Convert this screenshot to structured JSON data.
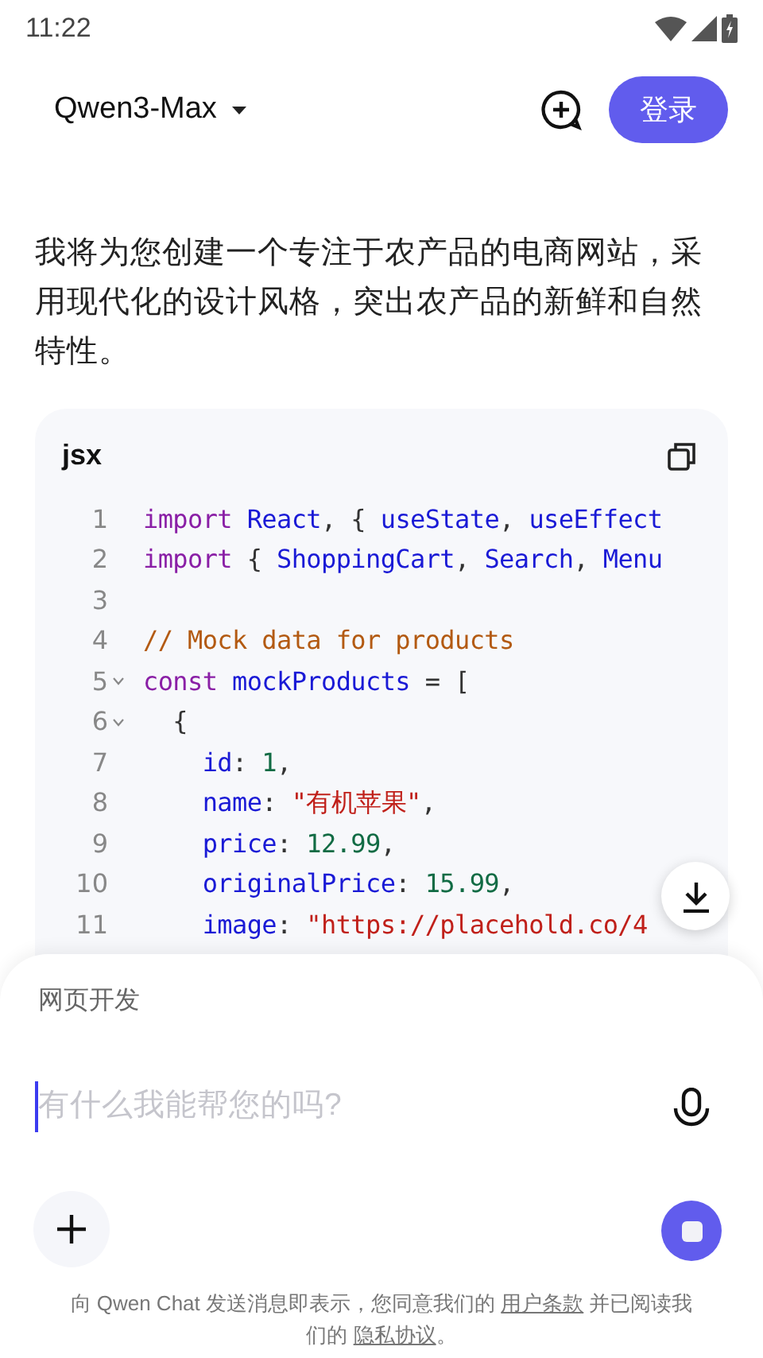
{
  "status_bar": {
    "time": "11:22"
  },
  "header": {
    "model": "Qwen3-Max",
    "login": "登录"
  },
  "message": {
    "text": "我将为您创建一个专注于农产品的电商网站，采用现代化的设计风格，突出农产品的新鲜和自然特性。"
  },
  "code_block": {
    "language": "jsx",
    "lines": [
      {
        "number": "1",
        "foldable": false,
        "tokens": [
          {
            "kind": "keyword",
            "text": "import "
          },
          {
            "kind": "name",
            "text": "React"
          },
          {
            "kind": "plain",
            "text": ", { "
          },
          {
            "kind": "name",
            "text": "useState"
          },
          {
            "kind": "plain",
            "text": ", "
          },
          {
            "kind": "name",
            "text": "useEffect"
          }
        ]
      },
      {
        "number": "2",
        "foldable": false,
        "tokens": [
          {
            "kind": "keyword",
            "text": "import "
          },
          {
            "kind": "plain",
            "text": "{ "
          },
          {
            "kind": "name",
            "text": "ShoppingCart"
          },
          {
            "kind": "plain",
            "text": ", "
          },
          {
            "kind": "name",
            "text": "Search"
          },
          {
            "kind": "plain",
            "text": ", "
          },
          {
            "kind": "name",
            "text": "Menu"
          }
        ]
      },
      {
        "number": "3",
        "foldable": false
      },
      {
        "number": "4",
        "foldable": false,
        "tokens": [
          {
            "kind": "comment",
            "text": "// Mock data for products"
          }
        ]
      },
      {
        "number": "5",
        "foldable": true,
        "tokens": [
          {
            "kind": "keyword",
            "text": "const "
          },
          {
            "kind": "name",
            "text": "mockProducts"
          },
          {
            "kind": "plain",
            "text": " = ["
          }
        ]
      },
      {
        "number": "6",
        "foldable": true,
        "tokens": [
          {
            "kind": "plain",
            "text": "  {"
          }
        ]
      },
      {
        "number": "7",
        "foldable": false,
        "tokens": [
          {
            "kind": "property",
            "text": "    id"
          },
          {
            "kind": "plain",
            "text": ": "
          },
          {
            "kind": "number",
            "text": "1"
          },
          {
            "kind": "plain",
            "text": ","
          }
        ]
      },
      {
        "number": "8",
        "foldable": false,
        "tokens": [
          {
            "kind": "property",
            "text": "    name"
          },
          {
            "kind": "plain",
            "text": ": "
          },
          {
            "kind": "string",
            "text": "\"有机苹果\""
          },
          {
            "kind": "plain",
            "text": ","
          }
        ]
      },
      {
        "number": "9",
        "foldable": false,
        "tokens": [
          {
            "kind": "property",
            "text": "    price"
          },
          {
            "kind": "plain",
            "text": ": "
          },
          {
            "kind": "number",
            "text": "12.99"
          },
          {
            "kind": "plain",
            "text": ","
          }
        ]
      },
      {
        "number": "10",
        "foldable": false,
        "tokens": [
          {
            "kind": "property",
            "text": "    originalPrice"
          },
          {
            "kind": "plain",
            "text": ": "
          },
          {
            "kind": "number",
            "text": "15.99"
          },
          {
            "kind": "plain",
            "text": ","
          }
        ]
      },
      {
        "number": "11",
        "foldable": false,
        "tokens": [
          {
            "kind": "property",
            "text": "    image"
          },
          {
            "kind": "plain",
            "text": ": "
          },
          {
            "kind": "string",
            "text": "\"https://placehold.co/4"
          }
        ]
      }
    ]
  },
  "composer": {
    "mode": "网页开发",
    "placeholder": "有什么我能帮您的吗?"
  },
  "footer": {
    "before": "向 Qwen Chat 发送消息即表示，您同意我们的",
    "terms": "用户条款",
    "middle": "并已阅读我们的",
    "privacy": "隐私协议",
    "end": "。"
  }
}
